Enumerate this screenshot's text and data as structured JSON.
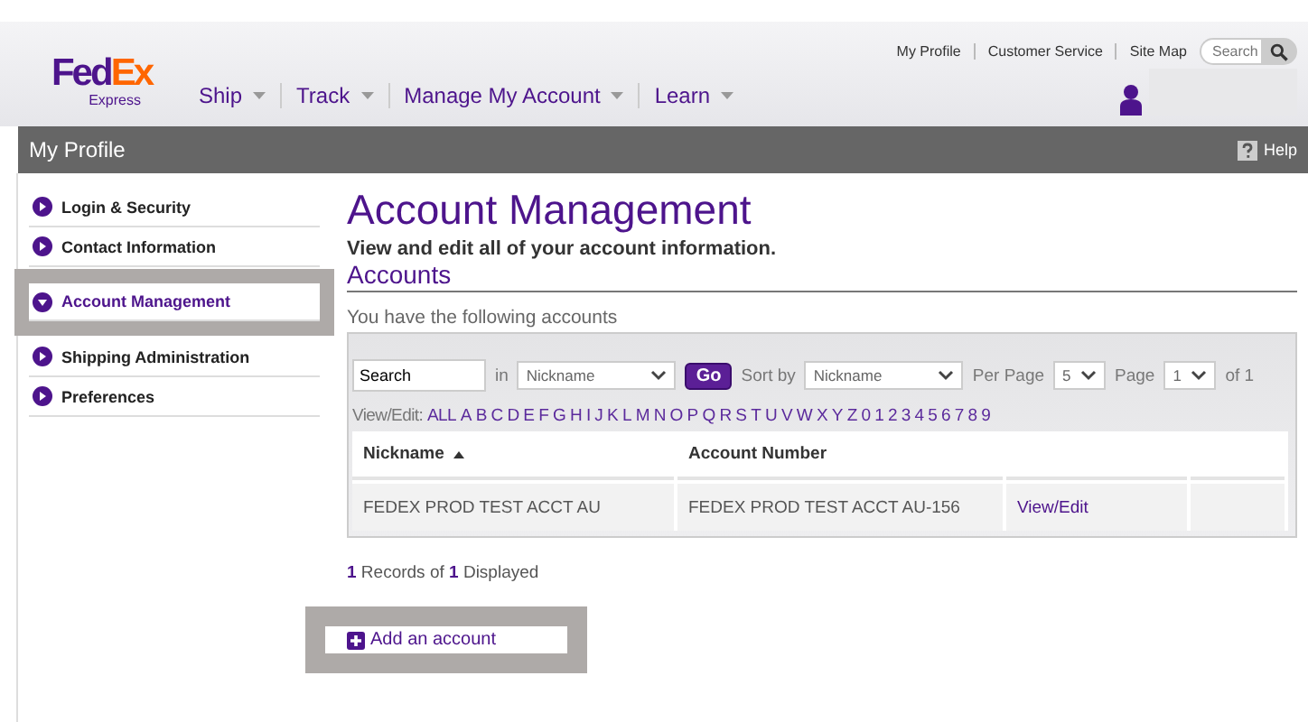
{
  "utility_links": [
    "My Profile",
    "Customer Service",
    "Site Map"
  ],
  "header_search": {
    "placeholder": "Search"
  },
  "logo": {
    "brand": "Fed",
    "brand_accent": "Ex",
    "sub": "Express"
  },
  "nav": [
    "Ship",
    "Track",
    "Manage My Account",
    "Learn"
  ],
  "title_bar": {
    "title": "My Profile",
    "help": "Help"
  },
  "sidebar": {
    "items": [
      {
        "label": "Login & Security",
        "selected": false,
        "highlighted": false
      },
      {
        "label": "Contact Information",
        "selected": false,
        "highlighted": false
      },
      {
        "label": "Account Management",
        "selected": true,
        "highlighted": true
      },
      {
        "label": "Shipping Administration",
        "selected": false,
        "highlighted": false
      },
      {
        "label": "Preferences",
        "selected": false,
        "highlighted": false
      }
    ]
  },
  "main": {
    "heading": "Account Management",
    "subheading": "View and edit all of your account information.",
    "section": "Accounts",
    "intro": "You have the following accounts"
  },
  "filter": {
    "search_value": "Search",
    "in_label": "in",
    "in_select": "Nickname",
    "go": "Go",
    "sort_label": "Sort by",
    "sort_select": "Nickname",
    "per_page_label": "Per Page",
    "per_page": "5",
    "page_label": "Page",
    "page": "1",
    "of": "of 1"
  },
  "view_edit": {
    "label": "View/Edit:",
    "letters": [
      "ALL",
      "A",
      "B",
      "C",
      "D",
      "E",
      "F",
      "G",
      "H",
      "I",
      "J",
      "K",
      "L",
      "M",
      "N",
      "O",
      "P",
      "Q",
      "R",
      "S",
      "T",
      "U",
      "V",
      "W",
      "X",
      "Y",
      "Z",
      "0",
      "1",
      "2",
      "3",
      "4",
      "5",
      "6",
      "7",
      "8",
      "9"
    ]
  },
  "table": {
    "columns": [
      {
        "label": "Nickname",
        "sorted": true
      },
      {
        "label": "Account Number",
        "sorted": false
      }
    ],
    "rows": [
      {
        "nickname": "FEDEX PROD TEST ACCT AU",
        "account_number": "FEDEX PROD TEST ACCT AU-156",
        "action": "View/Edit"
      }
    ]
  },
  "records": "**1** Records of **1** Displayed",
  "add_account": {
    "label": "Add an account",
    "highlighted": true
  }
}
